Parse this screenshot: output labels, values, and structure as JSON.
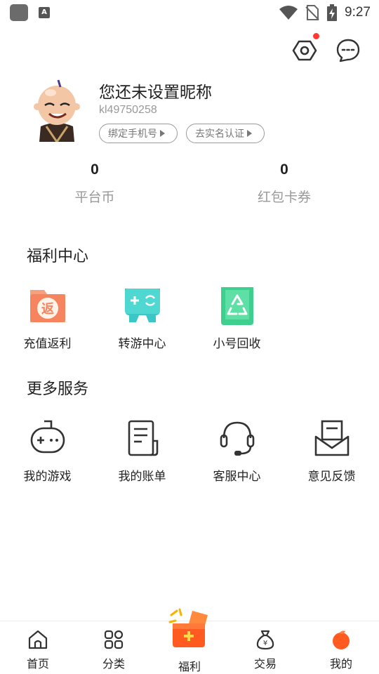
{
  "status_bar": {
    "time": "9:27",
    "a_icon": "A"
  },
  "profile": {
    "nickname": "您还未设置昵称",
    "user_id": "kl49750258",
    "bind_phone_label": "绑定手机号",
    "real_name_label": "去实名认证"
  },
  "stats": [
    {
      "value": "0",
      "label": "平台币"
    },
    {
      "value": "0",
      "label": "红包卡券"
    }
  ],
  "welfare": {
    "title": "福利中心",
    "items": [
      {
        "label": "充值返利",
        "icon": "rebate-icon"
      },
      {
        "label": "转游中心",
        "icon": "transfer-game-icon"
      },
      {
        "label": "小号回收",
        "icon": "recycle-icon"
      }
    ]
  },
  "services": {
    "title": "更多服务",
    "items": [
      {
        "label": "我的游戏",
        "icon": "gamepad-icon"
      },
      {
        "label": "我的账单",
        "icon": "bill-icon"
      },
      {
        "label": "客服中心",
        "icon": "headset-icon"
      },
      {
        "label": "意见反馈",
        "icon": "feedback-icon"
      }
    ]
  },
  "bottom_nav": [
    {
      "label": "首页",
      "icon": "home-icon"
    },
    {
      "label": "分类",
      "icon": "category-icon"
    },
    {
      "label": "福利",
      "icon": "welfare-icon"
    },
    {
      "label": "交易",
      "icon": "money-bag-icon"
    },
    {
      "label": "我的",
      "icon": "profile-icon",
      "active": true
    }
  ],
  "colors": {
    "rebate": "#f5845f",
    "transfer": "#3cc7c6",
    "recycle": "#3ecf8e",
    "accent": "#ff5a1f",
    "badge": "#ff3b30"
  }
}
